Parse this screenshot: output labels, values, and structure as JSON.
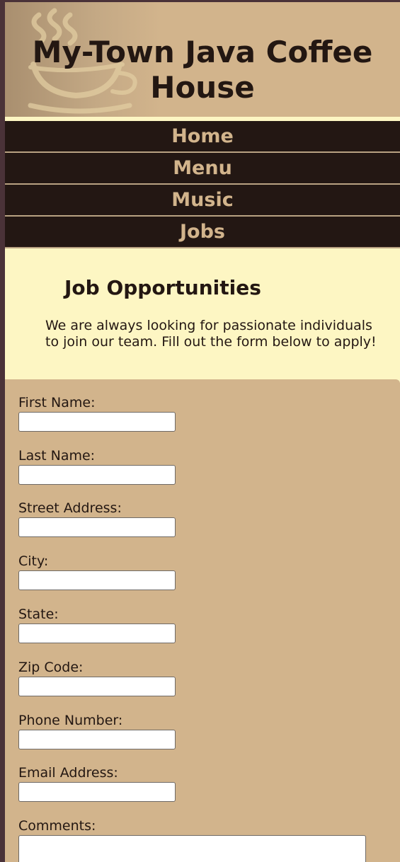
{
  "header": {
    "title": "My-Town Java Coffee House",
    "logo_icon": "coffee-cup-icon"
  },
  "nav": {
    "items": [
      {
        "label": "Home"
      },
      {
        "label": "Menu"
      },
      {
        "label": "Music"
      },
      {
        "label": "Jobs"
      }
    ]
  },
  "main": {
    "heading": "Job Opportunities",
    "intro": "We are always looking for passionate individuals to join our team. Fill out the form below to apply!"
  },
  "form": {
    "first_name": {
      "label": "First Name:",
      "value": ""
    },
    "last_name": {
      "label": "Last Name:",
      "value": ""
    },
    "street": {
      "label": "Street Address:",
      "value": ""
    },
    "city": {
      "label": "City:",
      "value": ""
    },
    "state": {
      "label": "State:",
      "value": ""
    },
    "zip": {
      "label": "Zip Code:",
      "value": ""
    },
    "phone": {
      "label": "Phone Number:",
      "value": ""
    },
    "email": {
      "label": "Email Address:",
      "value": ""
    },
    "comments": {
      "label": "Comments:",
      "value": ""
    }
  },
  "colors": {
    "header_tan": "#d2b48c",
    "nav_dark": "#231713",
    "content_cream": "#fdf6c3",
    "text_dark": "#231712",
    "outer_frame": "#4a3238"
  }
}
